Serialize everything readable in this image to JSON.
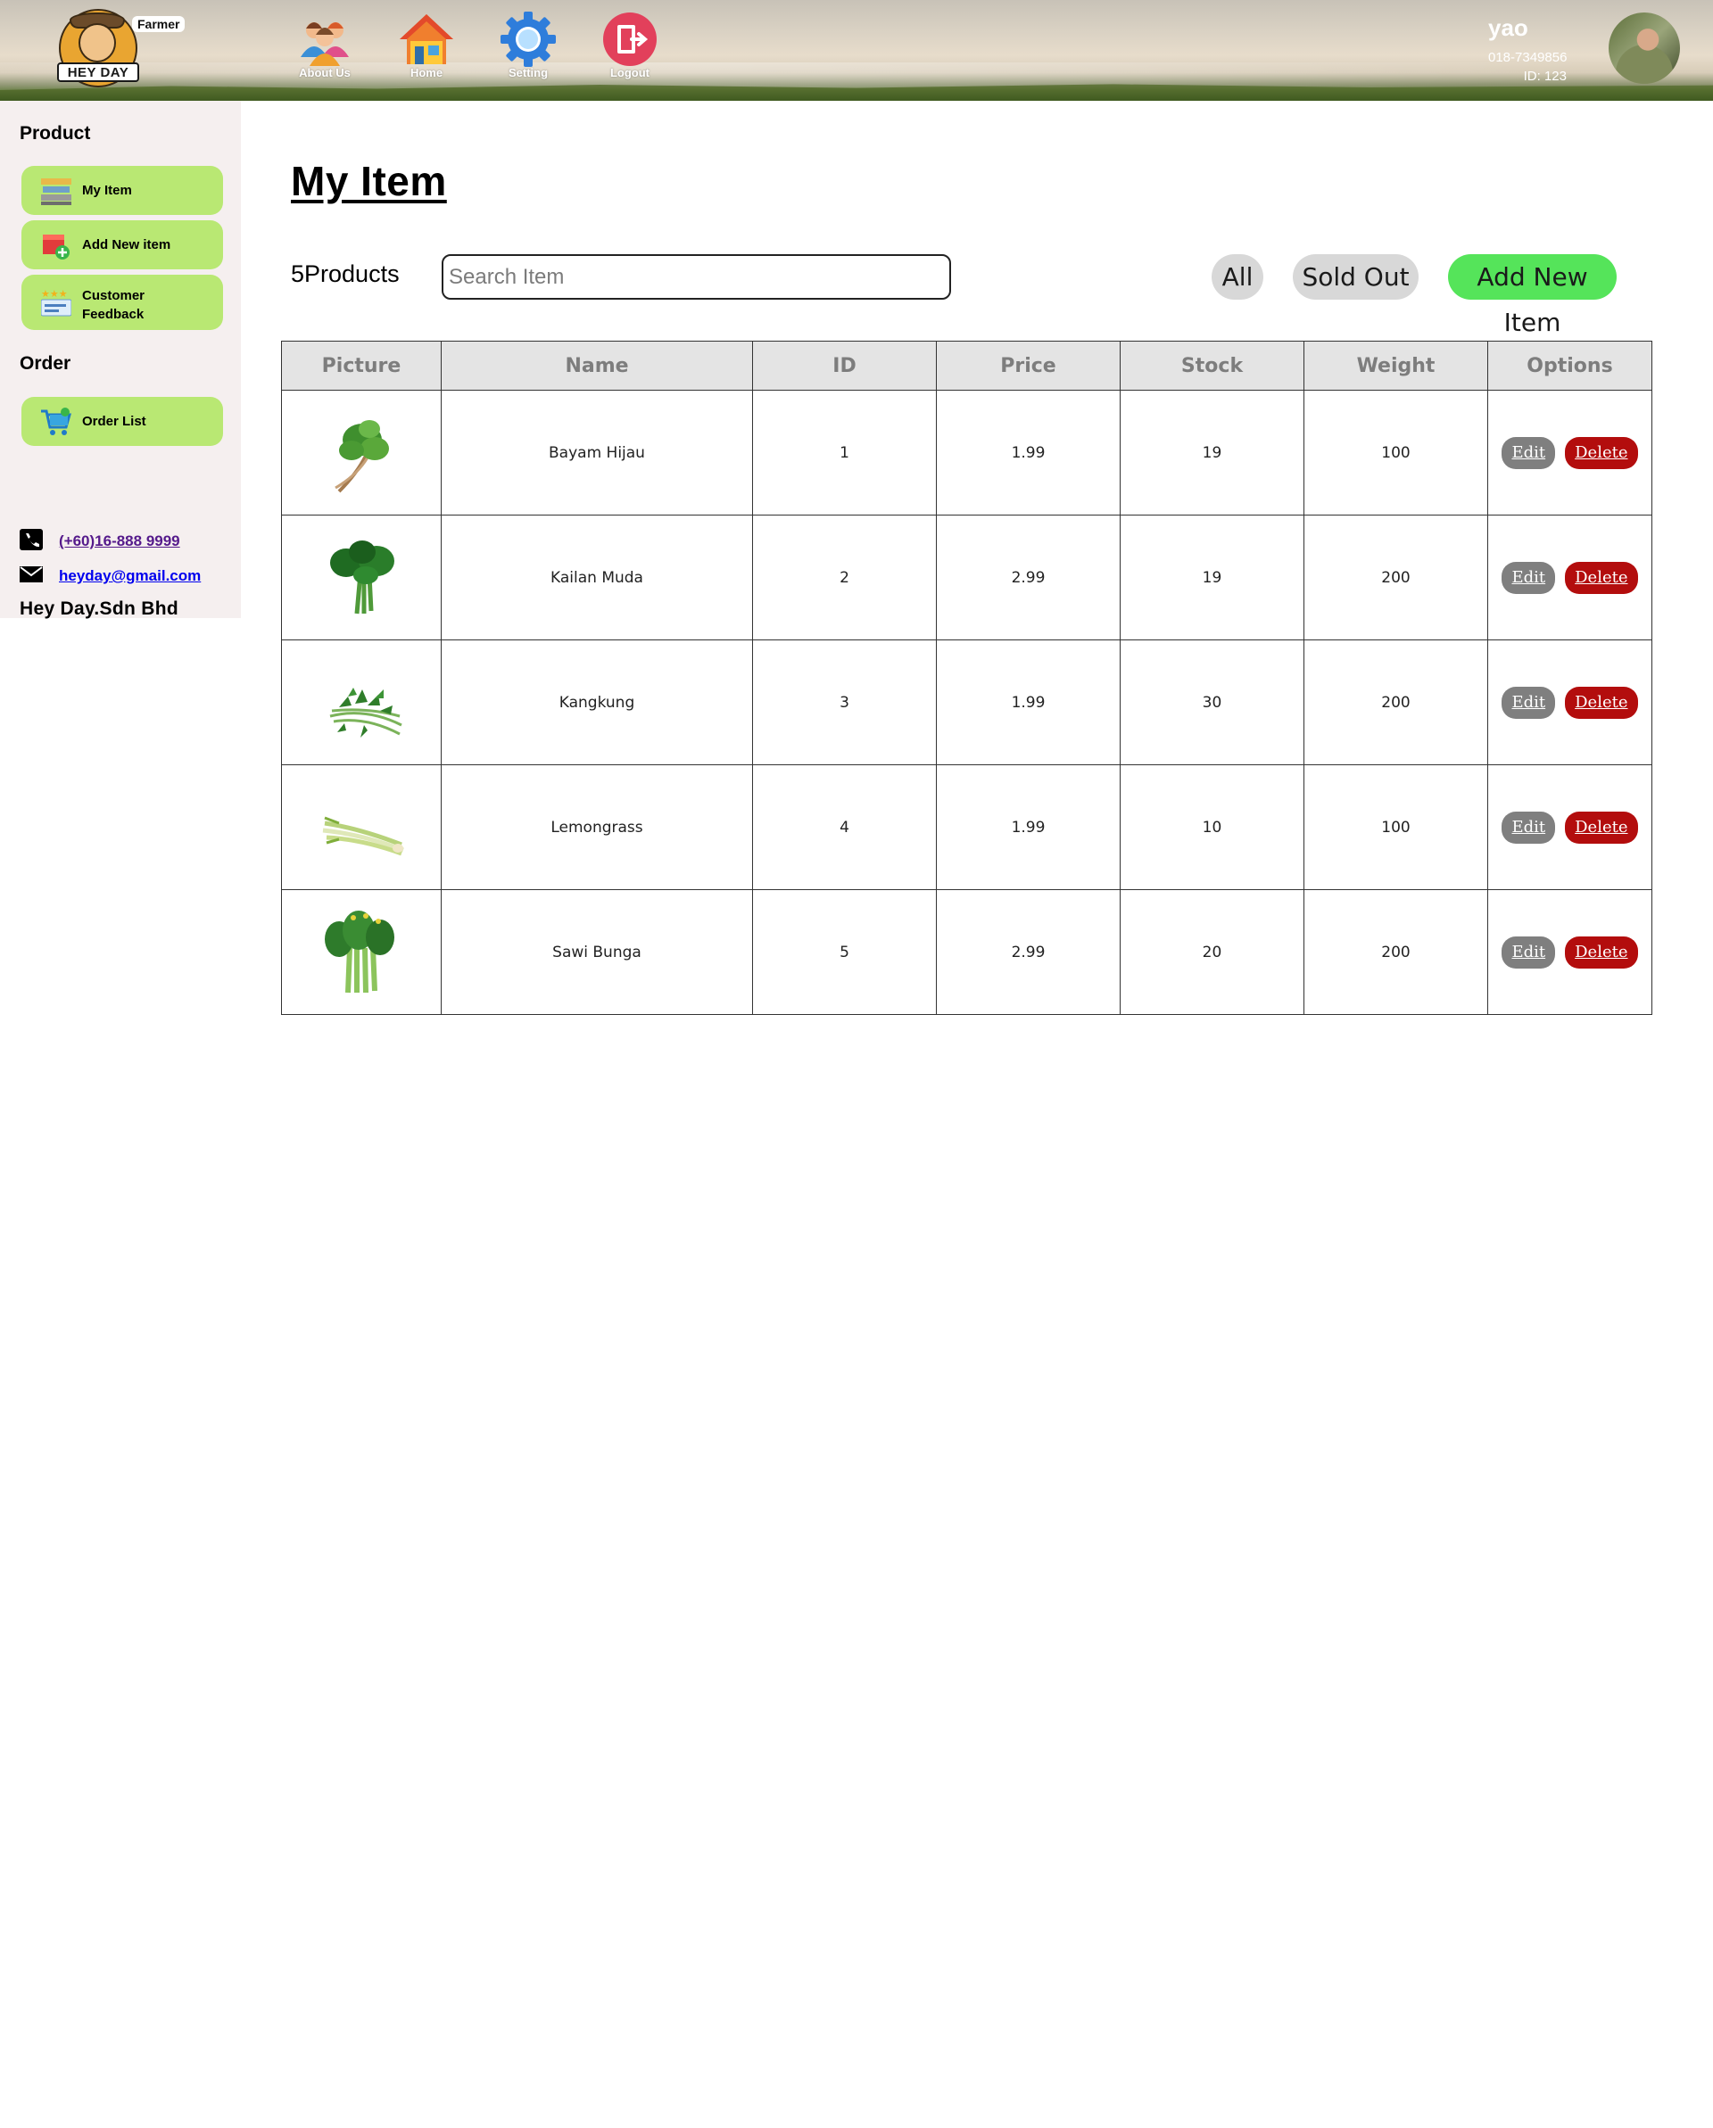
{
  "header": {
    "logo_text": "HEY DAY",
    "role_tag": "Farmer",
    "nav": [
      {
        "label": "About Us",
        "icon": "people-icon"
      },
      {
        "label": "Home",
        "icon": "house-icon"
      },
      {
        "label": "Setting",
        "icon": "gear-icon"
      },
      {
        "label": "Logout",
        "icon": "logout-icon"
      }
    ],
    "user": {
      "name": "yao",
      "phone": "018-7349856",
      "id_text": "ID: 123"
    }
  },
  "sidebar": {
    "product_heading": "Product",
    "product_items": [
      {
        "label": "My Item",
        "icon": "stacked-books-icon"
      },
      {
        "label": "Add New item",
        "icon": "box-add-icon"
      },
      {
        "label": "Customer\nFeedback",
        "icon": "rating-card-icon"
      }
    ],
    "order_heading": "Order",
    "order_items": [
      {
        "label": "Order List",
        "icon": "shopping-cart-icon"
      }
    ],
    "company": "Hey Day.Sdn Bhd",
    "phone": "(+60)16-888 9999",
    "email": "heyday@gmail.com"
  },
  "main": {
    "title": "My Item",
    "count_text": "5Products",
    "search_placeholder": "Search Item",
    "filters": {
      "all": "All",
      "sold_out": "Sold Out",
      "add_new": "Add New Item"
    },
    "columns": [
      "Picture",
      "Name",
      "ID",
      "Price",
      "Stock",
      "Weight",
      "Options"
    ],
    "rows": [
      {
        "picture": "spinach-bunch-icon",
        "name": "Bayam Hijau",
        "id": "1",
        "price": "1.99",
        "stock": "19",
        "weight": "100"
      },
      {
        "picture": "kailan-icon",
        "name": "Kailan Muda",
        "id": "2",
        "price": "2.99",
        "stock": "19",
        "weight": "200"
      },
      {
        "picture": "kangkung-icon",
        "name": "Kangkung",
        "id": "3",
        "price": "1.99",
        "stock": "30",
        "weight": "200"
      },
      {
        "picture": "lemongrass-icon",
        "name": "Lemongrass",
        "id": "4",
        "price": "1.99",
        "stock": "10",
        "weight": "100"
      },
      {
        "picture": "sawi-bunga-icon",
        "name": "Sawi Bunga",
        "id": "5",
        "price": "2.99",
        "stock": "20",
        "weight": "200"
      }
    ],
    "edit_label": "Edit",
    "delete_label": "Delete"
  },
  "colors": {
    "sidebar_bg": "#f5efef",
    "sidebar_button": "#b9e873",
    "add_new_button": "#55e45a",
    "edit_button": "#7f7f7f",
    "delete_button": "#b30d0d"
  }
}
